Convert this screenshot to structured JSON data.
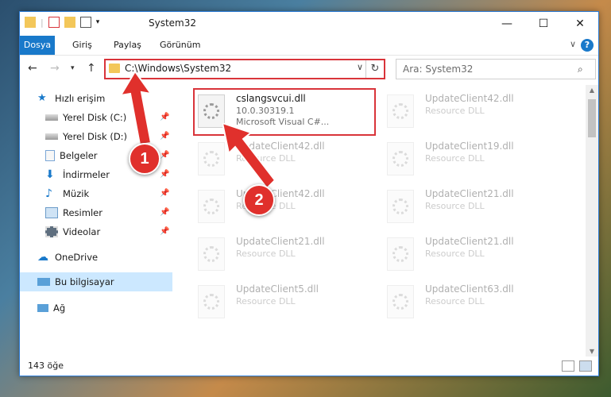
{
  "window": {
    "title": "System32"
  },
  "ribbon": {
    "tabs": [
      "Dosya",
      "Giriş",
      "Paylaş",
      "Görünüm"
    ],
    "help": "?"
  },
  "address": {
    "path": "C:\\Windows\\System32",
    "search_placeholder": "Ara: System32"
  },
  "nav": {
    "quick_access": "Hızlı erişim",
    "items": [
      "Yerel Disk (C:)",
      "Yerel Disk (D:)",
      "Belgeler",
      "İndirmeler",
      "Müzik",
      "Resimler",
      "Videolar"
    ],
    "onedrive": "OneDrive",
    "this_pc": "Bu bilgisayar",
    "network": "Ağ"
  },
  "files": {
    "main": {
      "name": "cslangsvcui.dll",
      "version": "10.0.30319.1",
      "desc": "Microsoft Visual C#..."
    },
    "bg_left": [
      {
        "name": "UpdateClient42.dll",
        "desc": "Resource DLL"
      },
      {
        "name": "UpdateClient42.dll",
        "desc": "Resource DLL"
      },
      {
        "name": "UpdateClient21.dll",
        "desc": "Resource DLL"
      },
      {
        "name": "UpdateClient5.dll",
        "desc": "Resource DLL"
      }
    ],
    "bg_right": [
      {
        "name": "UpdateClient42.dll",
        "desc": "Resource DLL"
      },
      {
        "name": "UpdateClient19.dll",
        "desc": "Resource DLL"
      },
      {
        "name": "UpdateClient21.dll",
        "desc": "Resource DLL"
      },
      {
        "name": "UpdateClient21.dll",
        "desc": "Resource DLL"
      },
      {
        "name": "UpdateClient63.dll",
        "desc": "Resource DLL"
      }
    ]
  },
  "status": {
    "count": "143 öğe"
  },
  "annotations": {
    "step1": "1",
    "step2": "2"
  },
  "colors": {
    "accent": "#1979ca",
    "highlight": "#d9343a",
    "badge": "#e0302c"
  }
}
